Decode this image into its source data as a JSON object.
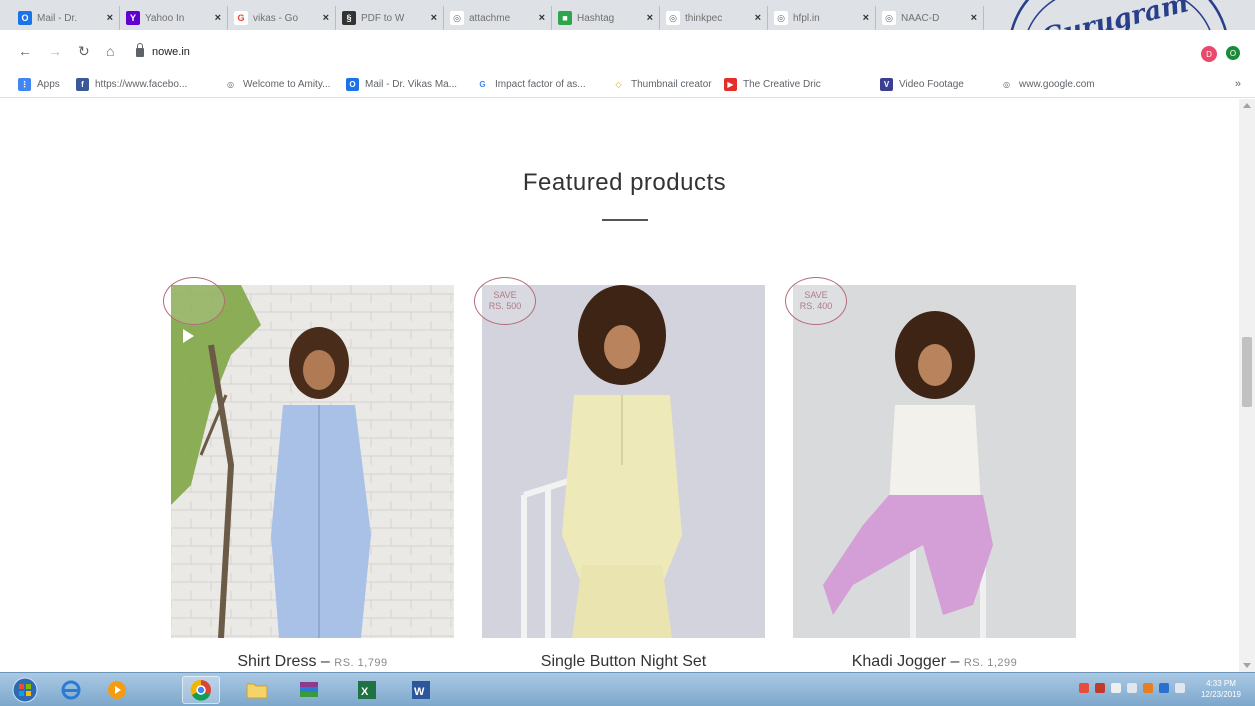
{
  "browser": {
    "tabs": [
      {
        "title": "Mail - Dr.",
        "favicon_color": "#1a73e8",
        "favicon_glyph": "O"
      },
      {
        "title": "Yahoo In",
        "favicon_color": "#6001d2",
        "favicon_glyph": "Y"
      },
      {
        "title": "vikas - Go",
        "favicon_color": "#ffffff",
        "favicon_glyph": "G"
      },
      {
        "title": "PDF to W",
        "favicon_color": "#333333",
        "favicon_glyph": "§"
      },
      {
        "title": "attachme",
        "favicon_color": "#5f6368",
        "favicon_glyph": "◎"
      },
      {
        "title": "Hashtag",
        "favicon_color": "#2ea44f",
        "favicon_glyph": "■"
      },
      {
        "title": "thinkpec",
        "favicon_color": "#5f6368",
        "favicon_glyph": "◎"
      },
      {
        "title": "hfpl.in",
        "favicon_color": "#5f6368",
        "favicon_glyph": "◎"
      },
      {
        "title": "NAAC-D",
        "favicon_color": "#5f6368",
        "favicon_glyph": "◎"
      }
    ],
    "url": "nowe.in",
    "profile_a": "D",
    "profile_b": "O",
    "bookmarks": [
      {
        "label": "Apps",
        "icon_color": "#4285f4",
        "glyph": "⋮"
      },
      {
        "label": "https://www.facebo...",
        "icon_color": "#3b5998",
        "glyph": "f"
      },
      {
        "label": "Welcome to Amity...",
        "icon_color": "#5f6368",
        "glyph": "◎"
      },
      {
        "label": "Mail - Dr. Vikas Ma...",
        "icon_color": "#1a73e8",
        "glyph": "O"
      },
      {
        "label": "Impact factor of as...",
        "icon_color": "#ffffff",
        "glyph": "G"
      },
      {
        "label": "Thumbnail creator",
        "icon_color": "#ffffff",
        "glyph": "◇"
      },
      {
        "label": "The Creative Dric",
        "icon_color": "#e52d27",
        "glyph": "▶"
      },
      {
        "label": "Video Footage",
        "icon_color": "#3b3f8f",
        "glyph": "V"
      },
      {
        "label": "www.google.com",
        "icon_color": "#5f6368",
        "glyph": "◎"
      }
    ],
    "bookmarks_more": "»"
  },
  "page": {
    "section_title": "Featured products",
    "products": [
      {
        "name": "Shirt Dress",
        "separator": "–",
        "price": "RS. 1,799",
        "badge_line1": "",
        "badge_line2": "",
        "image_bg": "#e8e6e3",
        "garment_color": "#a9c1e6"
      },
      {
        "name": "Single Button Night Set",
        "separator": "",
        "price": "",
        "badge_line1": "SAVE",
        "badge_line2": "RS. 500",
        "image_bg": "#d2d3dc",
        "garment_color": "#eee9b8"
      },
      {
        "name": "Khadi Jogger",
        "separator": "–",
        "price": "RS. 1,299",
        "badge_line1": "SAVE",
        "badge_line2": "RS. 400",
        "image_bg": "#d9dadc",
        "garment_color": "#d49fd6"
      }
    ]
  },
  "stamp": {
    "text": "Gurugram"
  },
  "taskbar": {
    "clock_time": "4:33 PM",
    "clock_date": "12/23/2019"
  }
}
